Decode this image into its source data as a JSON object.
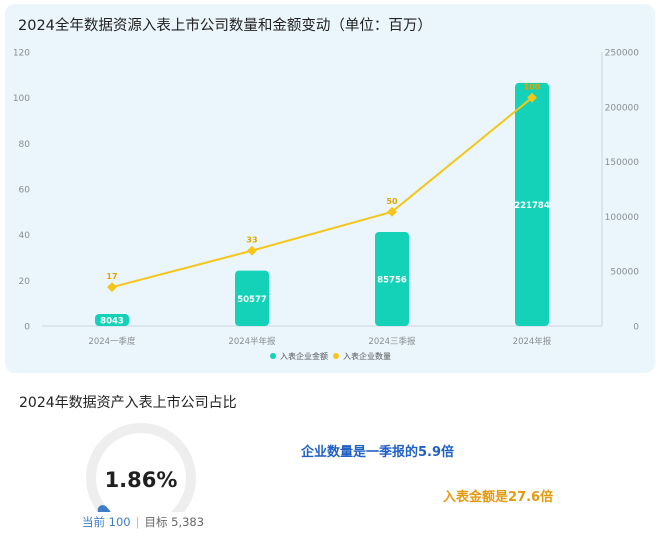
{
  "chart": {
    "title": "2024全年数据资源入表上市公司数量和金额变动（单位：百万）"
  },
  "chart_data": {
    "type": "bar",
    "categories": [
      "2024一季度",
      "2024半年报",
      "2024三季报",
      "2024年报"
    ],
    "series": [
      {
        "name": "入表企业金额",
        "type": "bar",
        "axis": "right",
        "values": [
          8043,
          50577,
          85756,
          221784
        ],
        "color": "#14d2b8"
      },
      {
        "name": "入表企业数量",
        "type": "line",
        "axis": "left",
        "values": [
          17,
          33,
          50,
          100
        ],
        "color": "#f5c518"
      }
    ],
    "y_left": {
      "ticks": [
        0,
        20,
        40,
        60,
        80,
        100,
        120
      ],
      "range": [
        0,
        120
      ]
    },
    "y_right": {
      "ticks": [
        0,
        50000,
        100000,
        150000,
        200000,
        250000
      ],
      "range": [
        0,
        250000
      ]
    },
    "legend_position": "bottom-center",
    "grid": false
  },
  "share": {
    "title": "2024年数据资产入表上市公司占比",
    "value_text": "1.86%",
    "fraction": 0.0186,
    "current_label": "当前 100",
    "target_label": "目标 5,383"
  },
  "insights": {
    "count": "企业数量是一季报的5.9倍",
    "amount": "入表金额是27.6倍"
  },
  "colors": {
    "bar": "#14d2b8",
    "line": "#f5c518",
    "card_bg": "#eaf6fb",
    "gauge_track": "#eeeeee",
    "gauge_fill": "#3d7cc9",
    "count_text": "#2160c4",
    "amount_text": "#e39a0f"
  }
}
